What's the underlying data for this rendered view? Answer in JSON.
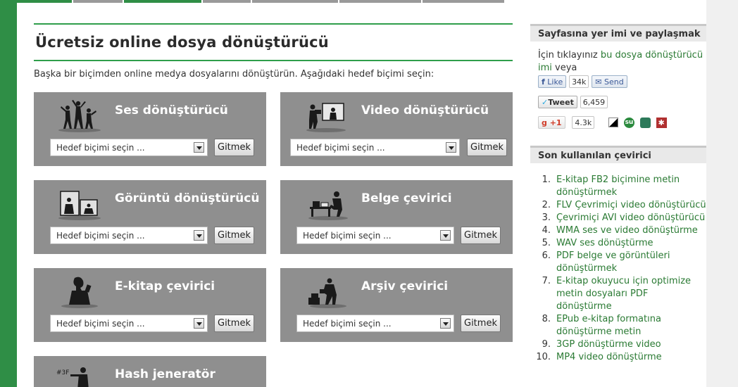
{
  "main": {
    "title": "Ücretsiz online dosya dönüştürücü",
    "intro": "Başka bir biçimden online medya dosyalarını dönüştürün. Aşağıdaki hedef biçimi seçin:",
    "select_placeholder": "Hedef biçimi seçin ...",
    "go_label": "Gitmek",
    "cards": [
      {
        "title": "Ses dönüştürücü",
        "icon": "dancers-icon"
      },
      {
        "title": "Video dönüştürücü",
        "icon": "video-camera-icon"
      },
      {
        "title": "Görüntü dönüştürücü",
        "icon": "image-frames-icon"
      },
      {
        "title": "Belge çevirici",
        "icon": "document-worker-icon"
      },
      {
        "title": "E-kitap çevirici",
        "icon": "ebook-reader-icon"
      },
      {
        "title": "Arşiv çevirici",
        "icon": "archive-worker-icon"
      },
      {
        "title": "Hash jeneratör",
        "icon": "hash-person-icon"
      }
    ]
  },
  "sidebar": {
    "share_heading": "Sayfasına yer imi ve paylaşmak",
    "share_prefix": "İçin tıklayınız ",
    "share_link": "bu dosya dönüştürücü imi",
    "share_suffix": " veya",
    "like_label": "Like",
    "like_count": "34k",
    "send_label": "Send",
    "tweet_label": "Tweet",
    "tweet_count": "6,459",
    "gplus_label": "+1",
    "gplus_count": "4.3k",
    "recent_heading": "Son kullanılan çevirici",
    "recent": [
      {
        "num": "1.",
        "text": "E-kitap FB2 biçimine metin dönüştürmek"
      },
      {
        "num": "2.",
        "text": "FLV Çevrimiçi video dönüştürücü"
      },
      {
        "num": "3.",
        "text": "Çevrimiçi AVI video dönüştürücü"
      },
      {
        "num": "4.",
        "text": "WMA ses ve video dönüştürme"
      },
      {
        "num": "5.",
        "text": "WAV ses dönüştürme"
      },
      {
        "num": "6.",
        "text": "PDF belge ve görüntüleri dönüştürmek"
      },
      {
        "num": "7.",
        "text": "E-kitap okuyucu için optimize metin dosyaları PDF dönüştürme"
      },
      {
        "num": "8.",
        "text": "EPub e-kitap formatına dönüştürme metin"
      },
      {
        "num": "9.",
        "text": "3GP dönüştürme video"
      },
      {
        "num": "10.",
        "text": "MP4 video dönüştürme"
      }
    ]
  },
  "colors": {
    "accent": "#2f9e4b",
    "card": "#8f8f8f",
    "link": "#2a7a33"
  }
}
